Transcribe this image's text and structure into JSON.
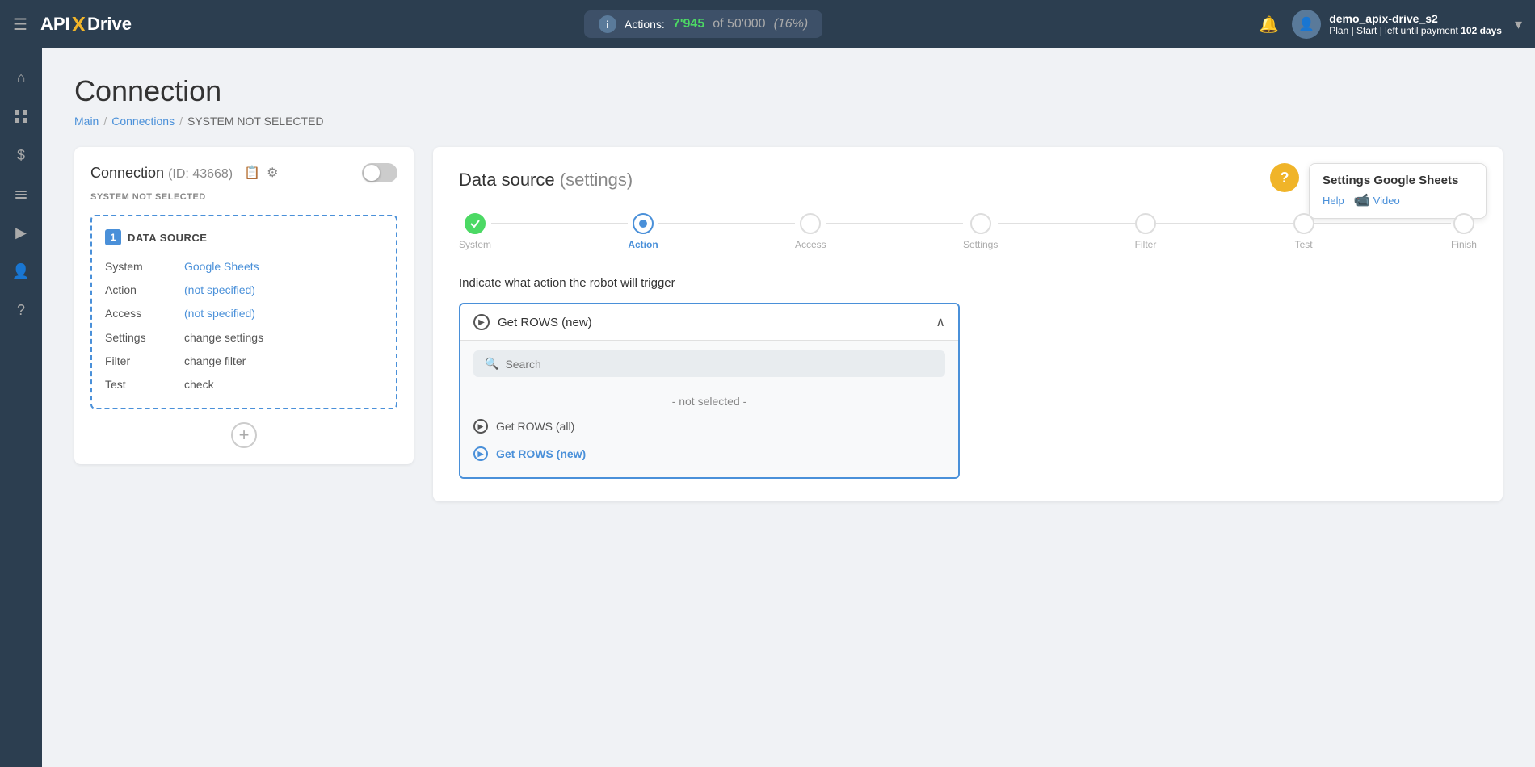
{
  "topnav": {
    "logo": {
      "api": "API",
      "x": "X",
      "drive": "Drive"
    },
    "actions_label": "Actions:",
    "actions_count": "7'945",
    "actions_of": "of",
    "actions_total": "50'000",
    "actions_pct": "(16%)",
    "bell_icon": "🔔",
    "user_avatar_icon": "👤",
    "user_name": "demo_apix-drive_s2",
    "user_plan_label": "Plan",
    "user_plan_separator": "|",
    "user_plan_type": "Start",
    "user_plan_left": "| left until payment",
    "user_plan_days": "102 days",
    "chevron": "▾"
  },
  "sidebar": {
    "items": [
      {
        "icon": "⌂",
        "name": "home"
      },
      {
        "icon": "⋮⋮",
        "name": "dashboard"
      },
      {
        "icon": "$",
        "name": "billing"
      },
      {
        "icon": "🧰",
        "name": "tools"
      },
      {
        "icon": "▶",
        "name": "play"
      },
      {
        "icon": "👤",
        "name": "user"
      },
      {
        "icon": "?",
        "name": "help"
      }
    ]
  },
  "page": {
    "title": "Connection",
    "breadcrumb": {
      "main": "Main",
      "connections": "Connections",
      "current": "SYSTEM NOT SELECTED"
    }
  },
  "connection_card": {
    "title": "Connection",
    "id_label": "(ID: 43668)",
    "system_not_selected": "SYSTEM NOT SELECTED",
    "datasource": {
      "number": "1",
      "label": "DATA SOURCE",
      "rows": [
        {
          "key": "System",
          "value": "Google Sheets",
          "type": "blue"
        },
        {
          "key": "Action",
          "value": "(not specified)",
          "type": "blue"
        },
        {
          "key": "Access",
          "value": "(not specified)",
          "type": "blue"
        },
        {
          "key": "Settings",
          "value": "change settings",
          "type": "gray"
        },
        {
          "key": "Filter",
          "value": "change filter",
          "type": "gray"
        },
        {
          "key": "Test",
          "value": "check",
          "type": "gray"
        }
      ]
    },
    "add_button": "+"
  },
  "settings_panel": {
    "title": "Data source",
    "title_paren": "(settings)",
    "steps": [
      {
        "label": "System",
        "state": "done"
      },
      {
        "label": "Action",
        "state": "active"
      },
      {
        "label": "Access",
        "state": "inactive"
      },
      {
        "label": "Settings",
        "state": "inactive"
      },
      {
        "label": "Filter",
        "state": "inactive"
      },
      {
        "label": "Test",
        "state": "inactive"
      },
      {
        "label": "Finish",
        "state": "inactive"
      }
    ],
    "dropdown_label": "Indicate what action the robot will trigger",
    "dropdown_selected": "Get ROWS (new)",
    "search_placeholder": "Search",
    "dropdown_not_selected": "- not selected -",
    "dropdown_options": [
      {
        "label": "Get ROWS (all)",
        "selected": false
      },
      {
        "label": "Get ROWS (new)",
        "selected": true
      }
    ]
  },
  "help": {
    "title": "Settings Google Sheets",
    "help_link": "Help",
    "video_icon": "📹",
    "video_label": "Video"
  }
}
